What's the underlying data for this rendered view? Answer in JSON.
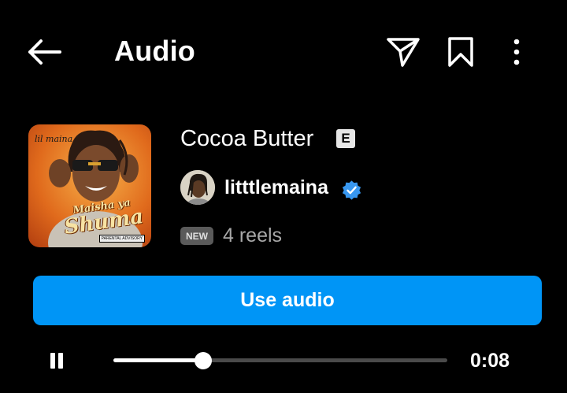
{
  "header": {
    "title": "Audio",
    "icons": {
      "back": "arrow-left-icon",
      "share": "send-icon",
      "save": "bookmark-icon",
      "more": "more-vertical-icon"
    }
  },
  "cover": {
    "artist_text": "lil maina",
    "title_line1": "Maisha ya",
    "title_line2": "Shuma",
    "badge": "PARENTAL ADVISORY"
  },
  "track": {
    "title": "Cocoa Butter",
    "explicit_label": "E",
    "artist": "litttlemaina",
    "verified": true,
    "new_badge": "NEW",
    "reels": "4 reels"
  },
  "actions": {
    "use_audio": "Use audio"
  },
  "player": {
    "state": "playing",
    "progress": 0.27,
    "elapsed": "0:08"
  },
  "colors": {
    "background": "#000000",
    "accent": "#0095f6",
    "verified": "#3897f0",
    "muted_text": "#a8a8a8"
  }
}
